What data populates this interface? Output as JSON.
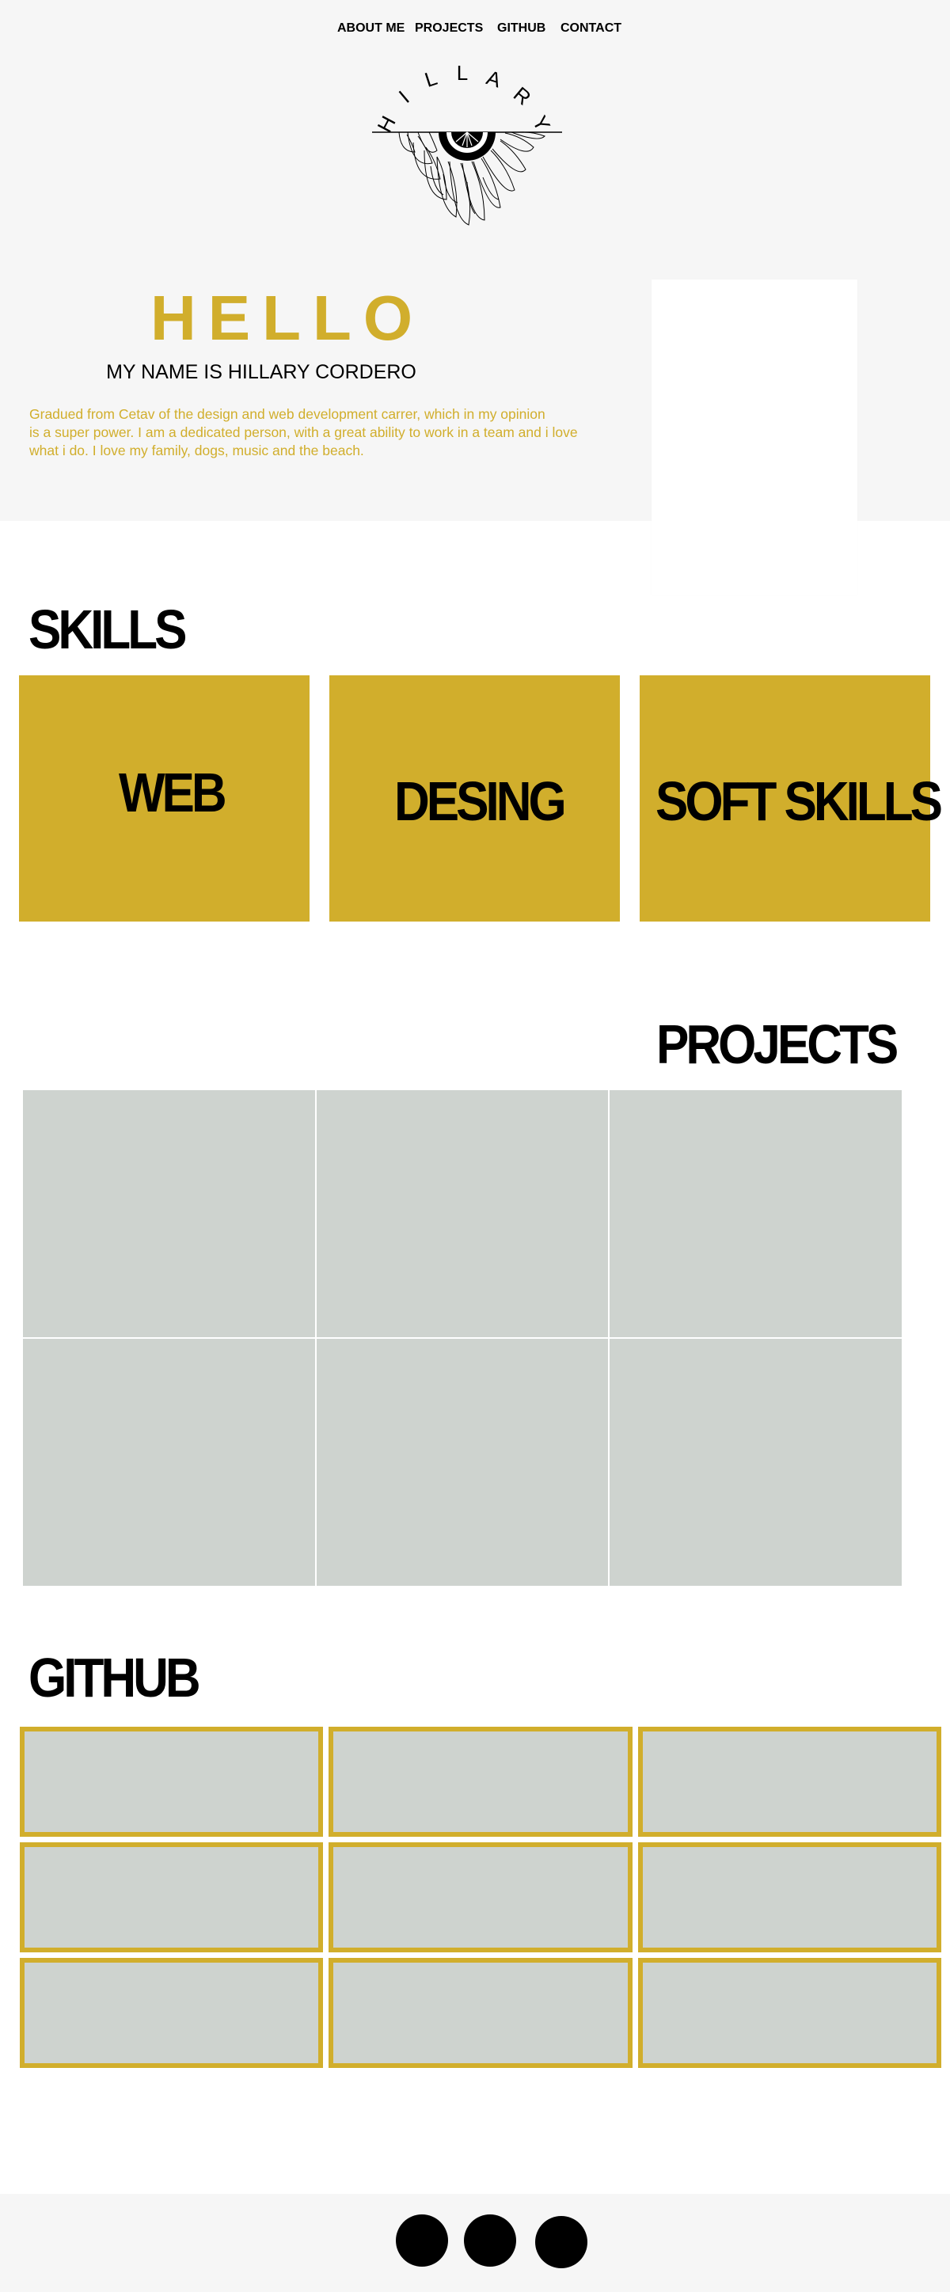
{
  "nav": {
    "items": [
      {
        "label": "ABOUT ME"
      },
      {
        "label": "PROJECTS"
      },
      {
        "label": "GITHUB"
      },
      {
        "label": "CONTACT"
      }
    ]
  },
  "logo": {
    "text": "HILLARY",
    "letters": [
      "H",
      "I",
      "L",
      "L",
      "A",
      "R",
      "Y"
    ],
    "icon": "sunflower-icon"
  },
  "hero": {
    "greeting": "HELLO",
    "name": "MY NAME IS HILLARY CORDERO",
    "bio_lines": [
      "Gradued from Cetav of the design and web development carrer, which in my opinion",
      "is a super power. I am a dedicated person, with a great ability to work in a team and i love",
      "what i do. I love my family, dogs, music and the beach."
    ]
  },
  "skills": {
    "title": "SKILLS",
    "cards": [
      {
        "label": "WEB"
      },
      {
        "label": "DESING"
      },
      {
        "label": "SOFT SKILLS"
      }
    ]
  },
  "projects": {
    "title": "PROJECTS",
    "tile_count": 6
  },
  "github": {
    "title": "GITHUB",
    "tile_count": 9
  },
  "footer": {
    "social_icons": [
      "social-icon-1",
      "social-icon-2",
      "social-icon-3"
    ]
  },
  "colors": {
    "accent": "#d1ae2c",
    "light_bg": "#f6f6f6",
    "tile_gray": "#ced3cf",
    "text": "#000000"
  }
}
